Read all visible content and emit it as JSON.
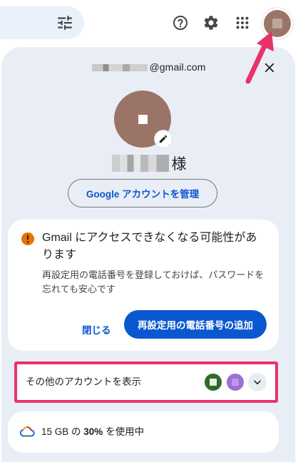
{
  "header": {
    "icons": [
      "tune-icon",
      "help-icon",
      "settings-icon",
      "apps-grid-icon",
      "account-avatar"
    ]
  },
  "account": {
    "email_suffix": "@gmail.com",
    "name_suffix": "様",
    "manage_button": "Google アカウントを管理"
  },
  "warning": {
    "title": "Gmail にアクセスできなくなる可能性があります",
    "body": "再設定用の電話番号を登録しておけば、パスワードを忘れても安心です",
    "dismiss_label": "閉じる",
    "action_label": "再設定用の電話番号の追加"
  },
  "other_accounts": {
    "label": "その他のアカウントを表示"
  },
  "storage": {
    "label_prefix": "15 GB の ",
    "percent": "30%",
    "label_suffix": " を使用中",
    "used_fraction": 0.3
  },
  "colors": {
    "accent_blue": "#0b57d0",
    "panel_bg": "#e9eef6",
    "annotation": "#e8336a",
    "warning_amber": "#e37400"
  }
}
